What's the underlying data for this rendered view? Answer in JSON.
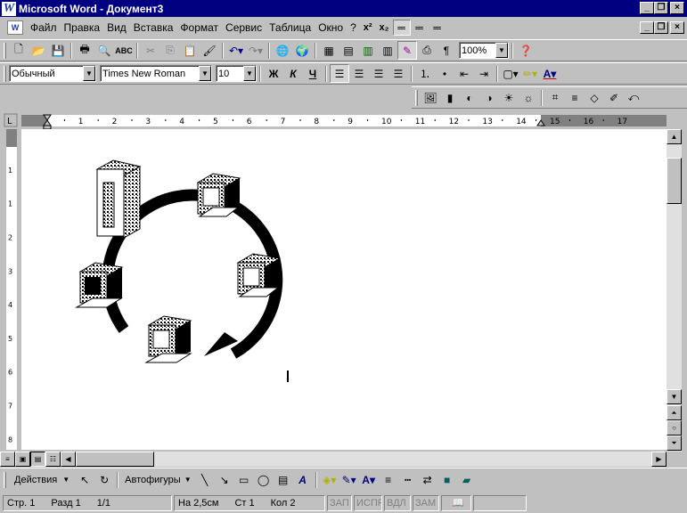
{
  "window": {
    "title": "Microsoft Word - Документ3",
    "logo": "W"
  },
  "menu": [
    {
      "label": "Файл"
    },
    {
      "label": "Правка"
    },
    {
      "label": "Вид"
    },
    {
      "label": "Вставка"
    },
    {
      "label": "Формат"
    },
    {
      "label": "Сервис"
    },
    {
      "label": "Таблица"
    },
    {
      "label": "Окно"
    },
    {
      "label": "?"
    },
    {
      "label": "x²"
    },
    {
      "label": "x₂"
    }
  ],
  "standard_toolbar": {
    "zoom": "100%"
  },
  "format_toolbar": {
    "style": "Обычный",
    "font": "Times New Roman",
    "size": "10",
    "bold": "Ж",
    "italic": "К",
    "underline": "Ч"
  },
  "ruler": {
    "marks": [
      "1",
      "2",
      "3",
      "4",
      "5",
      "6",
      "7",
      "8",
      "9",
      "10",
      "11",
      "12",
      "13",
      "14",
      "15",
      "16",
      "17"
    ],
    "vmarks": [
      "1",
      "1",
      "2",
      "3",
      "4",
      "5",
      "6",
      "7",
      "8"
    ]
  },
  "drawing_toolbar": {
    "actions": "Действия",
    "autoshapes": "Автофигуры"
  },
  "status": {
    "page": "Стр. 1",
    "section": "Разд 1",
    "pages": "1/1",
    "position": "На 2,5см",
    "line": "Ст 1",
    "column": "Кол 2",
    "rec": "ЗАП",
    "trk": "ИСПР",
    "ext": "ВДЛ",
    "ovr": "ЗАМ"
  },
  "colors": {
    "titlebar": "#000080",
    "face": "#c0c0c0"
  }
}
